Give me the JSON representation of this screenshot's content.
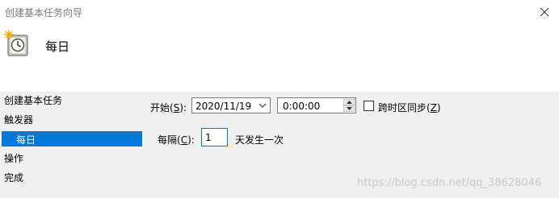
{
  "window": {
    "title": "创建基本任务向导"
  },
  "header": {
    "title": "每日",
    "icon": "clock-icon"
  },
  "nav": {
    "items": [
      {
        "label": "创建基本任务",
        "selected": false
      },
      {
        "label": "触发器",
        "selected": false
      },
      {
        "label": "每日",
        "selected": true
      },
      {
        "label": "操作",
        "selected": false
      },
      {
        "label": "完成",
        "selected": false
      }
    ]
  },
  "form": {
    "start_label": "开始(",
    "start_key": "S",
    "start_suffix": "):",
    "start_date": "2020/11/19",
    "start_time": "0:00:00",
    "sync_label_prefix": "跨时区同步(",
    "sync_key": "Z",
    "sync_label_suffix": ")",
    "sync_checked": false,
    "recur_label_prefix": "每隔(",
    "recur_key": "C",
    "recur_label_suffix": "):",
    "recur_value": "1",
    "recur_unit": "天发生一次"
  },
  "watermark": "https://blog.csdn.net/qq_38628046",
  "colors": {
    "selection": "#0078d7",
    "panel": "#f0f0f0"
  }
}
